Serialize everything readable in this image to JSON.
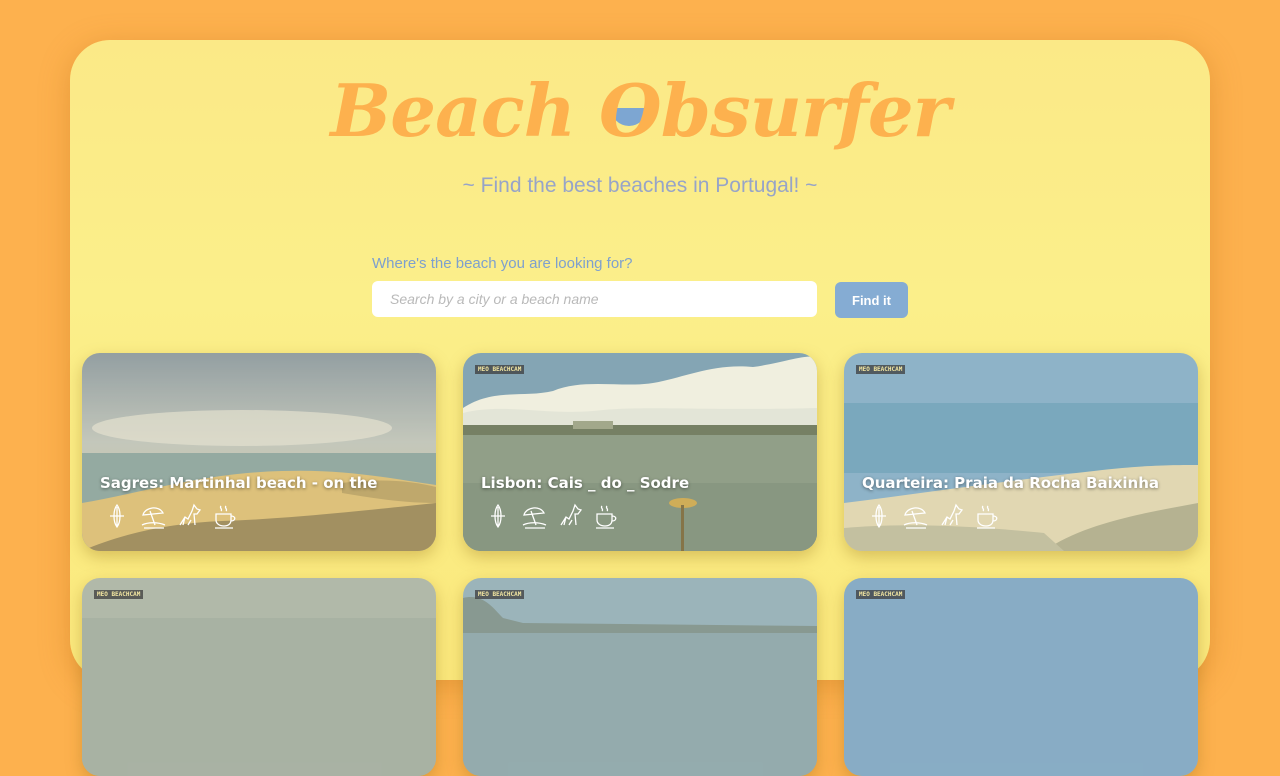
{
  "app": {
    "logo_text_1": "Beach",
    "logo_letter_o": "O",
    "logo_text_2": "bsurfer",
    "tagline": "~ Find the best beaches in Portugal! ~"
  },
  "search": {
    "label": "Where's the beach you are looking for?",
    "placeholder": "Search by a city or a beach name",
    "value": "",
    "button_label": "Find it"
  },
  "colors": {
    "background": "#fdb14e",
    "panel": "#fbec86",
    "accent_orange": "#fdb14e",
    "accent_blue": "#85acd3"
  },
  "beaches": [
    {
      "title": "Sagres: Martinhal beach - on the",
      "badge": "",
      "icons": [
        "surfboard-icon",
        "umbrella-icon",
        "dog-icon",
        "coffee-cup-icon"
      ]
    },
    {
      "title": "Lisbon: Cais _ do _ Sodre",
      "badge": "MEO BEACHCAM",
      "icons": [
        "surfboard-icon",
        "umbrella-icon",
        "dog-icon",
        "coffee-cup-icon"
      ]
    },
    {
      "title": "Quarteira: Praia da Rocha Baixinha",
      "badge": "MEO BEACHCAM",
      "icons": [
        "surfboard-icon",
        "umbrella-icon",
        "dog-icon",
        "coffee-cup-icon"
      ]
    },
    {
      "title": "",
      "badge": "MEO BEACHCAM",
      "icons": []
    },
    {
      "title": "",
      "badge": "MEO BEACHCAM",
      "icons": []
    },
    {
      "title": "",
      "badge": "MEO BEACHCAM",
      "icons": []
    }
  ]
}
